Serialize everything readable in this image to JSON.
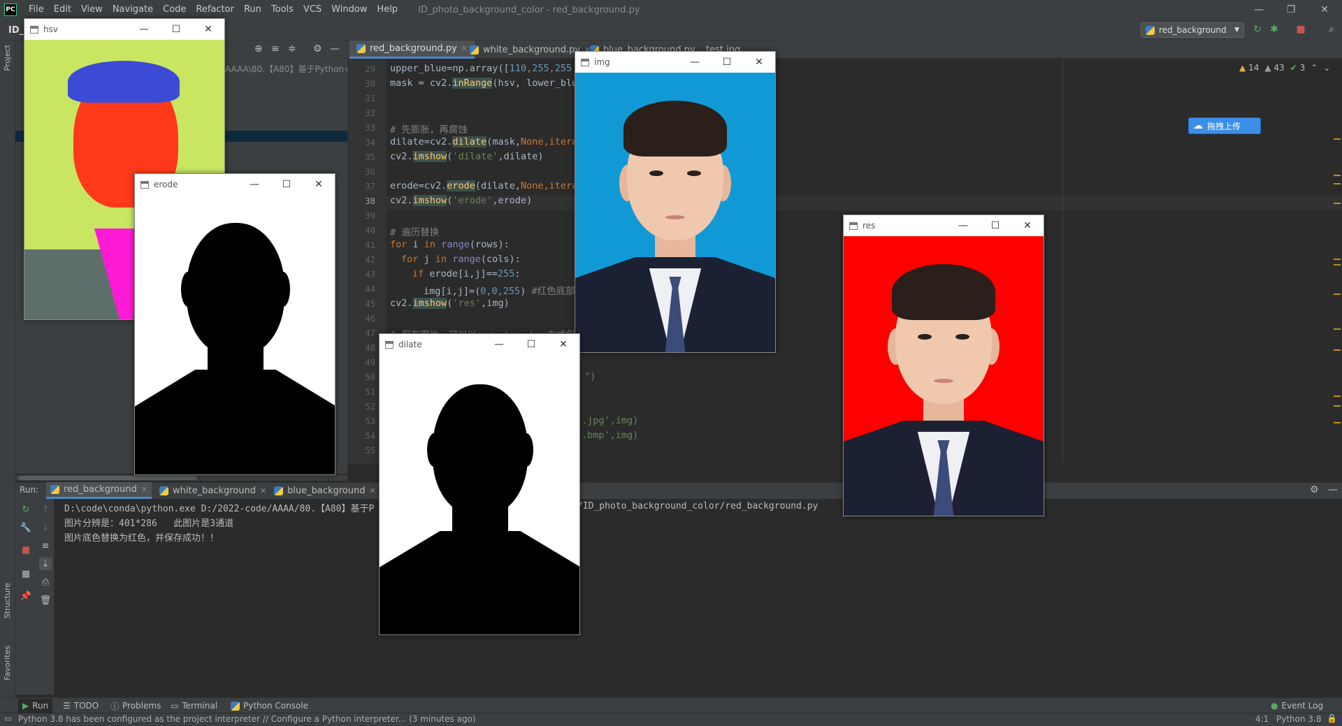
{
  "menubar": {
    "logo": "PC",
    "items": [
      "File",
      "Edit",
      "View",
      "Navigate",
      "Code",
      "Refactor",
      "Run",
      "Tools",
      "VCS",
      "Window",
      "Help"
    ],
    "title": "ID_photo_background_color - red_background.py"
  },
  "toolbar": {
    "project_crumb": "ID_",
    "run_config": "red_background"
  },
  "sidebar": {
    "project_label": "Project",
    "structure_label": "Structure",
    "favorites_label": "Favorites"
  },
  "project_panel": {
    "path_fragment": "AAAA\\80.【A80】基于Python+"
  },
  "editor_tabs": [
    {
      "label": "red_background.py"
    },
    {
      "label": "white_background.py"
    },
    {
      "label": "blue_background.py"
    },
    {
      "label": "test.ipg"
    }
  ],
  "editor": {
    "line_numbers": [
      "29",
      "30",
      "31",
      "32",
      "33",
      "34",
      "35",
      "36",
      "37",
      "38",
      "39",
      "40",
      "41",
      "42",
      "43",
      "44",
      "45",
      "46",
      "47",
      "48",
      "49",
      "50",
      "51",
      "52",
      "53",
      "54",
      "55"
    ],
    "current_line": "38",
    "inspections": {
      "warnings": "14",
      "weak_warnings": "43",
      "ok": "3"
    },
    "lines": {
      "l29a": "upper_blue=np.array([",
      "l29n": "110",
      "l29b": ",",
      "l29c": "255",
      ",": ",",
      "l29d": "255",
      "l30a": "mask = cv2.",
      "l30f": "inRange",
      "l30b": "(hsv, lower_blu",
      "l33": "# 先膨胀，再腐蚀",
      "l34a": "dilate=cv2.",
      "l34f": "dilate",
      "l34b": "(mask,",
      "l34k": "None",
      "l34c": "itera",
      "l35a": "cv2.",
      "l35f": "imshow",
      "l35b": "(",
      "l35s": "'dilate'",
      "l35c": ",dilate)",
      "l37a": "erode=cv2.",
      "l37f": "erode",
      "l37b": "(dilate,",
      "l37k": "None",
      "l37c": "itera",
      "l38a": "cv2.",
      "l38f": "imshow",
      "l38b": "(",
      "l38s": "'erode'",
      "l38c": ",erode)",
      "l40": "# 遍历替换",
      "l41k": "for",
      "l41a": " i ",
      "l41k2": "in",
      "l41b": " ",
      "l41bi": "range",
      "l41c": "(rows):",
      "l42k": "for",
      "l42a": " j ",
      "l42k2": "in",
      "l42b": " ",
      "l42bi": "range",
      "l42c": "(cols):",
      "l43k": "if",
      "l43a": " erode[i,j]==",
      "l43n": "255",
      "l43c": ":",
      "l44a": "img[i,j]=(",
      "l44n": "0,0,255",
      "l44c": ")",
      "l44m": " #红色底部",
      "l45a": "cv2.",
      "l45f": "imshow",
      "l45b": "(",
      "l45s": "'res'",
      "l45c": ",img)",
      "l47": "# 保存图片，可以以png，jpg，bmp方式保存",
      "l50": "! \")",
      "l53": ".jpg',img)",
      "l54": ".bmp',img)"
    },
    "upload_button": "拖拽上传"
  },
  "run_panel": {
    "label": "Run:",
    "tabs": [
      {
        "label": "red_background"
      },
      {
        "label": "white_background"
      },
      {
        "label": "blue_background"
      }
    ],
    "console": [
      "D:\\code\\conda\\python.exe D:/2022-code/AAAA/80.【A80】基于P",
      "图片分辨是：401*286   此图片是3通道",
      "图片底色替换为红色，并保存成功！！"
    ],
    "console_tail": "/ID_photo_background_color/red_background.py"
  },
  "bottom_tools": [
    {
      "label": "Run"
    },
    {
      "label": "TODO"
    },
    {
      "label": "Problems"
    },
    {
      "label": "Terminal"
    },
    {
      "label": "Python Console"
    }
  ],
  "event_log": "Event Log",
  "status": {
    "message": "Python 3.8 has been configured as the project interpreter // Configure a Python interpreter... (3 minutes ago)",
    "position": "4:1",
    "interpreter": "Python 3.8"
  },
  "windows": {
    "hsv": {
      "title": "hsv"
    },
    "erode": {
      "title": "erode"
    },
    "img": {
      "title": "img",
      "bg": "#1199d6"
    },
    "dilate": {
      "title": "dilate"
    },
    "res": {
      "title": "res",
      "bg": "#ff0000"
    }
  },
  "colors": {
    "accent": "#4a88c7",
    "keyword": "#cc7832",
    "function": "#ffc66d",
    "number": "#6897bb",
    "string": "#6a8759"
  }
}
